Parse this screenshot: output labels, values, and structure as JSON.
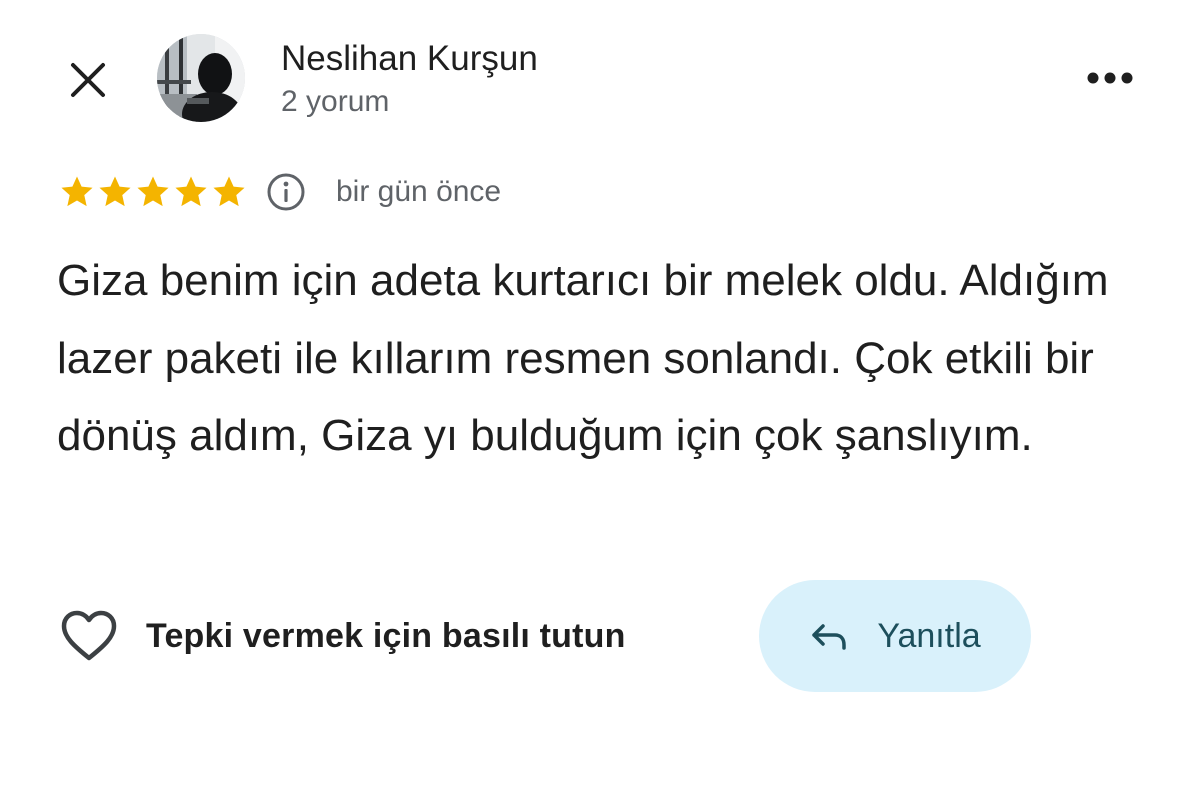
{
  "header": {
    "close_icon": "close-icon",
    "author_name": "Neslihan Kurşun",
    "author_meta": "2 yorum",
    "more_icon": "more-horizontal-icon"
  },
  "review": {
    "rating": 5,
    "max_rating": 5,
    "star_color": "#f4b400",
    "date": "bir gün önce",
    "text": "Giza benim için adeta kurtarıcı bir melek oldu. Aldığım lazer paketi ile kıllarım resmen sonlandı. Çok etkili bir dönüş aldım, Giza yı bulduğum için çok şanslıyım."
  },
  "actions": {
    "react_label": "Tepki vermek için basılı tutun",
    "reply_label": "Yanıtla",
    "reply_bg": "#d9f1fb"
  }
}
